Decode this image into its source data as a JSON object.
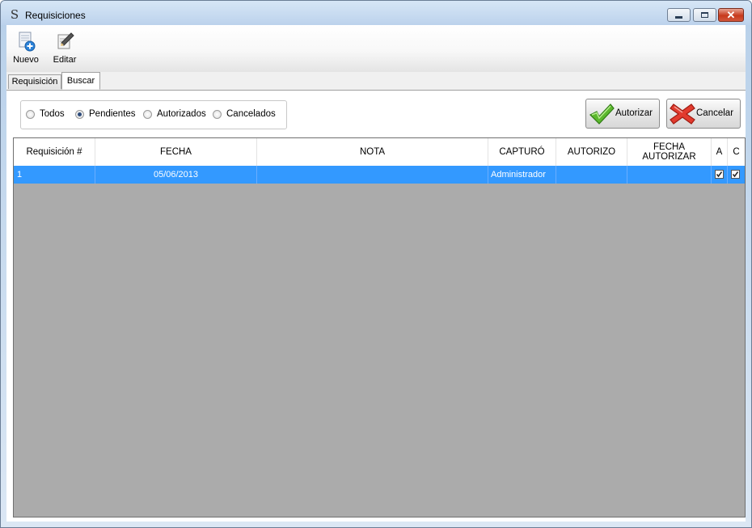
{
  "window": {
    "title": "Requisiciones",
    "icon": "s-logo-icon"
  },
  "toolbar": {
    "nuevo_label": "Nuevo",
    "editar_label": "Editar"
  },
  "tabs": [
    {
      "label": "Requisición",
      "active": false
    },
    {
      "label": "Buscar",
      "active": true
    }
  ],
  "filters": {
    "options": [
      "Todos",
      "Pendientes",
      "Autorizados",
      "Cancelados"
    ],
    "selected": "Pendientes"
  },
  "actions": {
    "autorizar_label": "Autorizar",
    "cancelar_label": "Cancelar"
  },
  "grid": {
    "columns": [
      "Requisición #",
      "FECHA",
      "NOTA",
      "CAPTURÓ",
      "AUTORIZO",
      "FECHA AUTORIZAR",
      "A",
      "C"
    ],
    "rows": [
      {
        "requisicion": "1",
        "fecha": "05/06/2013",
        "nota": "",
        "capturo": "Administrador",
        "autorizo": "",
        "fecha_autorizar": "",
        "a": true,
        "c": true
      }
    ],
    "selection_color": "#3399ff"
  }
}
